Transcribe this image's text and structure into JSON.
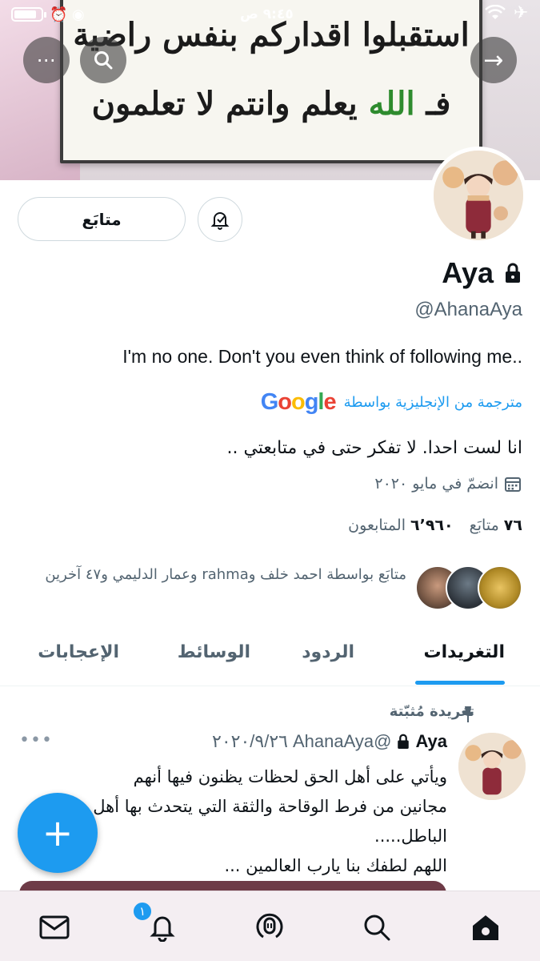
{
  "status_bar": {
    "time": "٩:٤٥ ص",
    "battery_level": 0.85
  },
  "banner": {
    "line1": "استقبلوا اقداركم بنفس راضية",
    "line2_prefix": "فـ ",
    "line2_green": "الله",
    "line2_suffix": " يعلم وانتم لا تعلمون"
  },
  "header_buttons": {
    "more": "⋯",
    "back": "→"
  },
  "profile": {
    "follow_label": "متابَع",
    "name": "Aya",
    "handle": "@AhanaAya",
    "bio": "I'm no one. Don't you even think of following me..",
    "translated_label": "مترجمة من الإنجليزية بواسطة",
    "bio_translated": "انا لست احدا. لا تفكر حتى في متابعتي ..",
    "joined": "انضمّ في مايو ٢٠٢٠",
    "following_count": "٧٦",
    "following_label": "متابَع",
    "followers_count": "٦٬٩٦٠",
    "followers_label": "المتابعون",
    "followed_by": "متابَع بواسطة احمد خلف وrahma وعمار الدليمي و٤٧ آخرين"
  },
  "tabs": [
    {
      "label": "التغريدات"
    },
    {
      "label": "الردود"
    },
    {
      "label": "الوسائط"
    },
    {
      "label": "الإعجابات"
    }
  ],
  "pinned_tweet": {
    "pinned_label": "تغريدة مُثبّتة",
    "name": "Aya",
    "handle": "@AhanaAya",
    "date": "٢٠٢٠/٩/٢٦",
    "more": "•••",
    "line1": "ويأتي على أهل الحق لحظات يظنون فيها أنهم",
    "line2": "مجانين من فرط الوقاحة والثقة التي يتحدث بها أهل",
    "line3": "الباطل.....",
    "line4": "اللهم لطفك بنا يارب العالمين ..."
  },
  "fab_label": "+",
  "bottom_nav": {
    "notifications_badge": "١"
  },
  "colors": {
    "accent": "#1d9bf0",
    "text": "#0f1419",
    "muted": "#536471"
  }
}
